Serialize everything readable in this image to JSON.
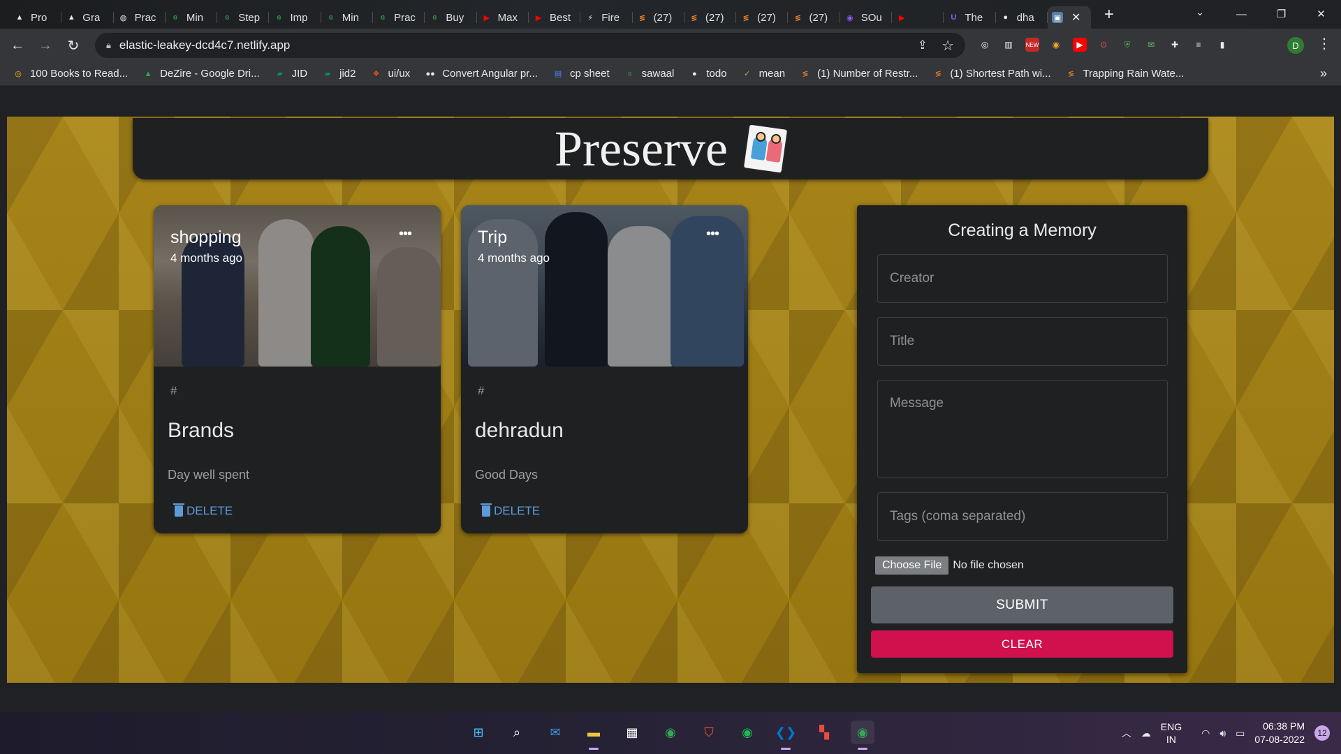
{
  "browser": {
    "tabs": [
      {
        "label": "Pro",
        "icon": "mountain-icon",
        "color": "#e8eaed"
      },
      {
        "label": "Gra",
        "icon": "mountain-icon",
        "color": "#e8eaed"
      },
      {
        "label": "Prac",
        "icon": "globe-icon",
        "color": "#e8eaed"
      },
      {
        "label": "Min",
        "icon": "gfg-icon",
        "color": "#2f8d46"
      },
      {
        "label": "Step",
        "icon": "gfg-icon",
        "color": "#2f8d46"
      },
      {
        "label": "Imp",
        "icon": "gfg-icon",
        "color": "#2f8d46"
      },
      {
        "label": "Min",
        "icon": "gfg-icon",
        "color": "#2f8d46"
      },
      {
        "label": "Prac",
        "icon": "gfg-icon",
        "color": "#2f8d46"
      },
      {
        "label": "Buy",
        "icon": "gfg-icon",
        "color": "#2f8d46"
      },
      {
        "label": "Max",
        "icon": "youtube-icon",
        "color": "#ff0000"
      },
      {
        "label": "Best",
        "icon": "youtube-icon",
        "color": "#ff0000"
      },
      {
        "label": "Fire",
        "icon": "bolt-icon",
        "color": "#e8eaed"
      },
      {
        "label": "(27)",
        "icon": "stackoverflow-icon",
        "color": "#f48024"
      },
      {
        "label": "(27)",
        "icon": "stackoverflow-icon",
        "color": "#f48024"
      },
      {
        "label": "(27)",
        "icon": "stackoverflow-icon",
        "color": "#f48024"
      },
      {
        "label": "(27)",
        "icon": "stackoverflow-icon",
        "color": "#f48024"
      },
      {
        "label": "SOu",
        "icon": "audio-icon",
        "color": "#8b5cf6"
      },
      {
        "label": "",
        "icon": "youtube-icon",
        "color": "#ff0000"
      },
      {
        "label": "The",
        "icon": "purple-u-icon",
        "color": "#8b5cf6"
      },
      {
        "label": "dha",
        "icon": "github-icon",
        "color": "#e8eaed"
      }
    ],
    "active_tab_close": "✕",
    "new_tab": "+",
    "url": "elastic-leakey-dcd4c7.netlify.app",
    "profile_initial": "D",
    "bookmarks": [
      {
        "label": "100 Books to Read...",
        "icon": "circle-icon",
        "color": "#f7b500"
      },
      {
        "label": "DeZire - Google Dri...",
        "icon": "drive-icon",
        "color": "#34a853"
      },
      {
        "label": "JID",
        "icon": "meet-icon",
        "color": "#00897b"
      },
      {
        "label": "jid2",
        "icon": "meet-icon",
        "color": "#00897b"
      },
      {
        "label": "ui/ux",
        "icon": "figma-icon",
        "color": "#f24e1e"
      },
      {
        "label": "Convert Angular pr...",
        "icon": "medium-icon",
        "color": "#e8eaed"
      },
      {
        "label": "cp sheet",
        "icon": "docs-icon",
        "color": "#4285f4"
      },
      {
        "label": "sawaal",
        "icon": "gfg-icon",
        "color": "#2f8d46"
      },
      {
        "label": "todo",
        "icon": "github-icon",
        "color": "#e8eaed"
      },
      {
        "label": "mean",
        "icon": "check-icon",
        "color": "#8bc34a"
      },
      {
        "label": "(1) Number of Restr...",
        "icon": "stackoverflow-icon",
        "color": "#f48024"
      },
      {
        "label": "(1) Shortest Path wi...",
        "icon": "stackoverflow-icon",
        "color": "#f48024"
      },
      {
        "label": "Trapping Rain Wate...",
        "icon": "stackoverflow-icon",
        "color": "#f48024"
      }
    ],
    "bookmarks_more": "»"
  },
  "app": {
    "title": "Preserve",
    "posts": [
      {
        "creator": "shopping",
        "time": "4 months ago",
        "more": "•••",
        "tags": "#",
        "title": "Brands",
        "message": "Day well spent",
        "delete_label": "DELETE"
      },
      {
        "creator": "Trip",
        "time": "4 months ago",
        "more": "•••",
        "tags": "#",
        "title": "dehradun",
        "message": "Good Days",
        "delete_label": "DELETE"
      }
    ],
    "form": {
      "heading": "Creating a Memory",
      "creator_placeholder": "Creator",
      "title_placeholder": "Title",
      "message_placeholder": "Message",
      "tags_placeholder": "Tags (coma separated)",
      "file_button": "Choose File",
      "file_status": "No file chosen",
      "submit_label": "SUBMIT",
      "clear_label": "CLEAR",
      "colors": {
        "submit": "#5c6268",
        "clear": "#d1104e"
      }
    }
  },
  "taskbar": {
    "apps": [
      {
        "icon": "windows-start-icon",
        "color": "#4cc2ff"
      },
      {
        "icon": "search-icon",
        "color": "#ffffff"
      },
      {
        "icon": "mail-icon",
        "color": "#3a96dd"
      },
      {
        "icon": "folder-icon",
        "color": "#f5c542"
      },
      {
        "icon": "store-icon",
        "color": "#ffffff"
      },
      {
        "icon": "chrome-icon",
        "color": "#34a853"
      },
      {
        "icon": "brave-icon",
        "color": "#fb542b"
      },
      {
        "icon": "spotify-icon",
        "color": "#1db954"
      },
      {
        "icon": "vscode-icon",
        "color": "#0078d4"
      },
      {
        "icon": "office-icon",
        "color": "#e74c3c"
      },
      {
        "icon": "chrome-icon",
        "color": "#34a853"
      }
    ],
    "lang_line1": "ENG",
    "lang_line2": "IN",
    "time": "06:38 PM",
    "date": "07-08-2022",
    "notifications": "12"
  }
}
